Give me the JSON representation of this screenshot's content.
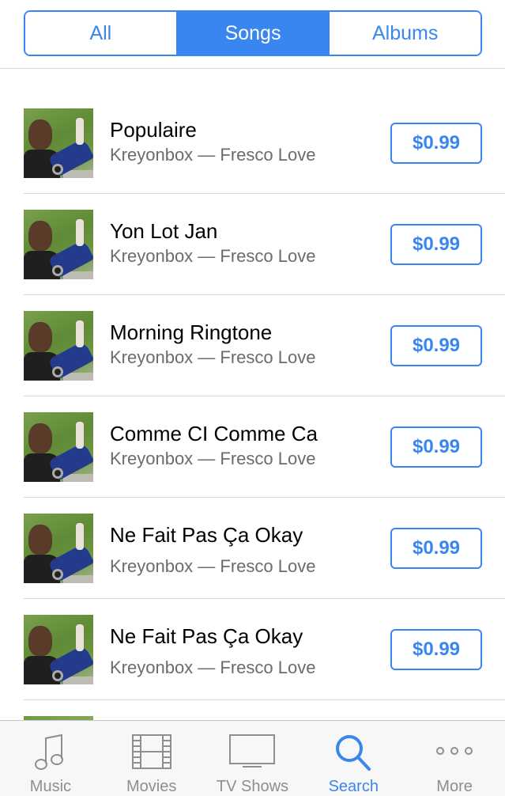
{
  "segments": [
    {
      "label": "All",
      "active": false
    },
    {
      "label": "Songs",
      "active": true
    },
    {
      "label": "Albums",
      "active": false
    }
  ],
  "songs": [
    {
      "title": "Populaire",
      "subtitle": "Kreyonbox — Fresco Love",
      "price": "$0.99"
    },
    {
      "title": "Yon Lot Jan",
      "subtitle": "Kreyonbox — Fresco Love",
      "price": "$0.99"
    },
    {
      "title": "Morning Ringtone",
      "subtitle": "Kreyonbox — Fresco Love",
      "price": "$0.99"
    },
    {
      "title": "Comme CI Comme Ca",
      "subtitle": "Kreyonbox — Fresco Love",
      "price": "$0.99"
    },
    {
      "title": "Ne Fait Pas Ça Okay",
      "subtitle": "Kreyonbox — Fresco Love",
      "price": "$0.99"
    },
    {
      "title": "Ne Fait Pas Ça Okay",
      "subtitle": "Kreyonbox — Fresco Love",
      "price": "$0.99"
    }
  ],
  "tabbar": {
    "items": [
      {
        "label": "Music",
        "icon": "music-note-icon",
        "active": false
      },
      {
        "label": "Movies",
        "icon": "film-strip-icon",
        "active": false
      },
      {
        "label": "TV Shows",
        "icon": "tv-icon",
        "active": false
      },
      {
        "label": "Search",
        "icon": "search-icon",
        "active": true
      },
      {
        "label": "More",
        "icon": "more-dots-icon",
        "active": false
      }
    ]
  },
  "colors": {
    "accent": "#3a86f0",
    "inactive": "#8e8e93",
    "subtitle": "#6b6b6b"
  }
}
